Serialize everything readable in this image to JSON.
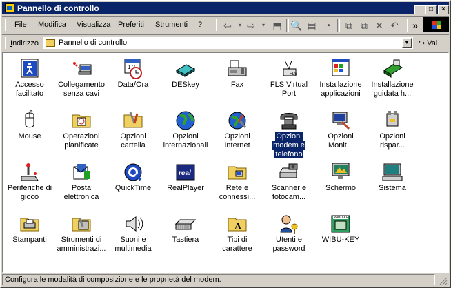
{
  "window": {
    "title": "Pannello di controllo"
  },
  "menu": [
    {
      "label": "File",
      "key": "F",
      "rest": "ile"
    },
    {
      "label": "Modifica",
      "key": "M",
      "rest": "odifica"
    },
    {
      "label": "Visualizza",
      "key": "V",
      "rest": "isualizza"
    },
    {
      "label": "Preferiti",
      "key": "P",
      "rest": "referiti"
    },
    {
      "label": "Strumenti",
      "key": "S",
      "rest": "trumenti"
    },
    {
      "label": "?",
      "key": "?",
      "rest": ""
    }
  ],
  "toolbar": {
    "overflow": "»"
  },
  "address": {
    "label_key": "I",
    "label_rest": "ndirizzo",
    "value": "Pannello di controllo",
    "go_label": "Vai"
  },
  "items": [
    {
      "l1": "Accesso",
      "l2": "facilitato",
      "icon": "accessibility-icon"
    },
    {
      "l1": "Collegamento",
      "l2": "senza cavi",
      "icon": "wireless-link-icon"
    },
    {
      "l1": "Data/Ora",
      "l2": "",
      "icon": "date-time-icon"
    },
    {
      "l1": "DESkey",
      "l2": "",
      "icon": "deskey-icon"
    },
    {
      "l1": "Fax",
      "l2": "",
      "icon": "fax-icon"
    },
    {
      "l1": "FLS Virtual",
      "l2": "Port",
      "icon": "fls-virtual-port-icon"
    },
    {
      "l1": "Installazione",
      "l2": "applicazioni",
      "icon": "add-remove-programs-icon"
    },
    {
      "l1": "Installazione",
      "l2": "guidata h...",
      "icon": "add-hardware-icon"
    },
    {
      "l1": "Mouse",
      "l2": "",
      "icon": "mouse-icon"
    },
    {
      "l1": "Operazioni",
      "l2": "pianificate",
      "icon": "scheduled-tasks-icon"
    },
    {
      "l1": "Opzioni",
      "l2": "cartella",
      "icon": "folder-options-icon"
    },
    {
      "l1": "Opzioni",
      "l2": "internazionali",
      "icon": "regional-options-icon"
    },
    {
      "l1": "Opzioni",
      "l2": "Internet",
      "icon": "internet-options-icon"
    },
    {
      "l1": "Opzioni",
      "l2": "modem e",
      "l3": "telefono",
      "icon": "phone-modem-icon",
      "selected": true
    },
    {
      "l1": "Opzioni",
      "l2": "Monit...",
      "icon": "monitor-options-icon"
    },
    {
      "l1": "Opzioni",
      "l2": "rispar...",
      "icon": "power-options-icon"
    },
    {
      "l1": "Periferiche di",
      "l2": "gioco",
      "icon": "game-controllers-icon"
    },
    {
      "l1": "Posta",
      "l2": "elettronica",
      "icon": "mail-icon"
    },
    {
      "l1": "QuickTime",
      "l2": "",
      "icon": "quicktime-icon"
    },
    {
      "l1": "RealPlayer",
      "l2": "",
      "icon": "realplayer-icon"
    },
    {
      "l1": "Rete e",
      "l2": "connessi...",
      "icon": "network-connections-icon"
    },
    {
      "l1": "Scanner e",
      "l2": "fotocam...",
      "icon": "scanners-cameras-icon"
    },
    {
      "l1": "Schermo",
      "l2": "",
      "icon": "display-icon"
    },
    {
      "l1": "Sistema",
      "l2": "",
      "icon": "system-icon"
    },
    {
      "l1": "Stampanti",
      "l2": "",
      "icon": "printers-icon"
    },
    {
      "l1": "Strumenti di",
      "l2": "amministrazi...",
      "icon": "admin-tools-icon"
    },
    {
      "l1": "Suoni e",
      "l2": "multimedia",
      "icon": "sounds-multimedia-icon"
    },
    {
      "l1": "Tastiera",
      "l2": "",
      "icon": "keyboard-icon"
    },
    {
      "l1": "Tipi di",
      "l2": "carattere",
      "icon": "fonts-icon"
    },
    {
      "l1": "Utenti e",
      "l2": "password",
      "icon": "users-passwords-icon"
    },
    {
      "l1": "WIBU-KEY",
      "l2": "",
      "icon": "wibu-key-icon"
    }
  ],
  "status": {
    "text": "Configura le modalità di composizione e le proprietà del modem."
  }
}
